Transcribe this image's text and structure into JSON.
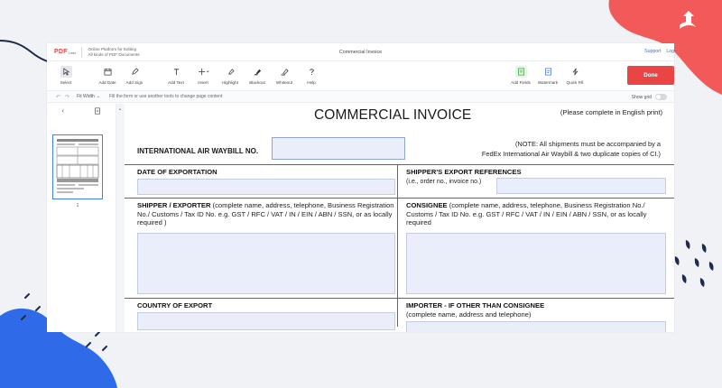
{
  "app": {
    "logo_main": "PDF",
    "logo_sub": "Liner",
    "tagline_line1": "Online Platform for Editing",
    "tagline_line2": "All kinds of PDF Documents",
    "document_title": "Commercial Invoice",
    "support_link": "Support",
    "login_link": "Log",
    "done_button": "Done"
  },
  "toolbar": {
    "tools_left": [
      {
        "label": "Select",
        "icon": "cursor-icon"
      },
      {
        "label": "Add Date",
        "icon": "calendar-icon"
      },
      {
        "label": "Add Sign",
        "icon": "pen-icon"
      },
      {
        "label": "Add Text",
        "icon": "text-icon"
      },
      {
        "label": "Insert",
        "icon": "plus-icon"
      },
      {
        "label": "Highlight",
        "icon": "highlight-icon"
      },
      {
        "label": "Blackout",
        "icon": "blackout-icon"
      },
      {
        "label": "Whiteout",
        "icon": "whiteout-icon"
      },
      {
        "label": "Help",
        "icon": "question-icon"
      }
    ],
    "tools_right": [
      {
        "label": "Add Fields",
        "icon": "fields-icon"
      },
      {
        "label": "Watermark",
        "icon": "watermark-icon"
      },
      {
        "label": "Quick Fill",
        "icon": "lightning-icon"
      }
    ]
  },
  "subbar": {
    "fit_width": "Fit Width",
    "hint": "Fill the form or use another tools to change page content",
    "show_grid": "Show grid"
  },
  "sidebar": {
    "page_number": "1"
  },
  "invoice": {
    "title": "COMMERCIAL INVOICE",
    "print_note": "(Please complete in English print)",
    "awb_label": "INTERNATIONAL AIR WAYBILL NO.",
    "note_line1": "(NOTE: All shipments must be accompanied by a",
    "note_line2": "FedEx International Air Waybill & two duplicate copies of CI.)",
    "date_label": "DATE OF EXPORTATION",
    "shipper_refs_label": "SHIPPER'S EXPORT REFERENCES",
    "shipper_refs_sub": "(i.e., order no., invoice no.)",
    "shipper_label": "SHIPPER / EXPORTER",
    "shipper_desc": " (complete name, address, telephone, Business Registration No./ Customs / Tax ID No. e.g. GST / RFC / VAT / IN / EIN / ABN / SSN, or as locally required )",
    "consignee_label": "CONSIGNEE",
    "consignee_desc": " (complete name, address, telephone, Business Registration No./ Customs / Tax ID No. e.g. GST / RFC / VAT / IN / EIN / ABN / SSN, or as locally required",
    "country_label": "COUNTRY OF EXPORT",
    "importer_label": "IMPORTER - IF OTHER THAN CONSIGNEE",
    "importer_sub": "(complete name, address and telephone)"
  },
  "colors": {
    "brand_red": "#e94545",
    "accent_blue": "#3b82f6",
    "field_bg": "#e9eefa"
  }
}
